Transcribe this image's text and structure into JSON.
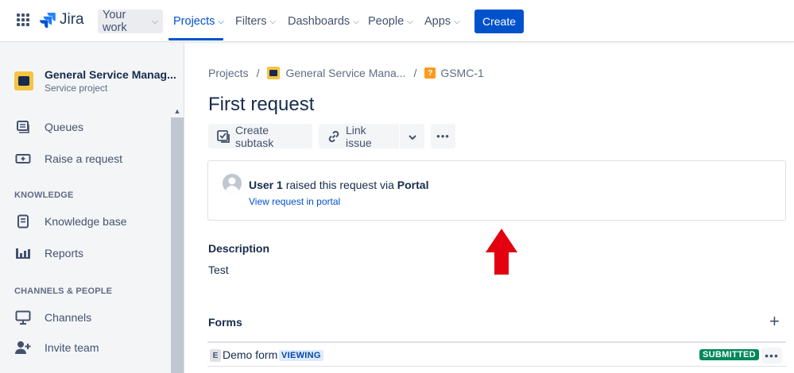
{
  "topnav": {
    "product": "Jira",
    "items": [
      {
        "label": "Your work"
      },
      {
        "label": "Projects"
      },
      {
        "label": "Filters"
      },
      {
        "label": "Dashboards"
      },
      {
        "label": "People"
      },
      {
        "label": "Apps"
      }
    ],
    "create_label": "Create"
  },
  "sidebar": {
    "project_name": "General Service Manag...",
    "project_type": "Service project",
    "items": [
      {
        "label": "Queues",
        "icon": "queues-icon"
      },
      {
        "label": "Raise a request",
        "icon": "raise-request-icon"
      },
      {
        "label": "Knowledge base",
        "icon": "knowledge-base-icon"
      },
      {
        "label": "Reports",
        "icon": "reports-icon"
      },
      {
        "label": "Channels",
        "icon": "channels-icon"
      },
      {
        "label": "Invite team",
        "icon": "invite-team-icon"
      }
    ],
    "sections": [
      "KNOWLEDGE",
      "CHANNELS & PEOPLE"
    ]
  },
  "breadcrumb": {
    "projects": "Projects",
    "project": "General Service Mana...",
    "issue_key": "GSMC-1",
    "separator": "/"
  },
  "issue": {
    "title": "First request",
    "create_subtask": "Create subtask",
    "link_issue": "Link issue",
    "more": "•••"
  },
  "request_info": {
    "user": "User 1",
    "raised_text": "raised this request via",
    "channel": "Portal",
    "portal_link": "View request in portal"
  },
  "description": {
    "heading": "Description",
    "text": "Test"
  },
  "forms": {
    "heading": "Forms",
    "add": "+",
    "rows": [
      {
        "letter": "E",
        "name": "Demo form",
        "viewing": "VIEWING",
        "status": "SUBMITTED",
        "more": "•••"
      }
    ]
  },
  "colors": {
    "brand": "#0052cc",
    "submitted": "#00875a",
    "annotation_arrow": "#e3000f"
  }
}
